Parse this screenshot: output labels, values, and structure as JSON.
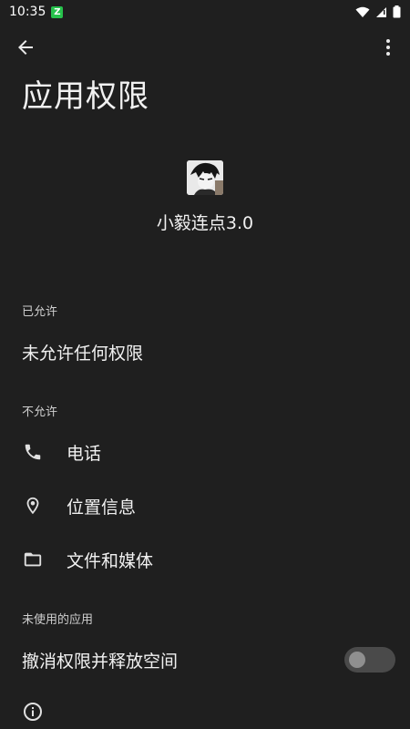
{
  "status_bar": {
    "time": "10:35",
    "app_badge_char": "Z"
  },
  "header": {
    "title": "应用权限"
  },
  "app": {
    "name": "小毅连点3.0"
  },
  "sections": {
    "allowed": {
      "label": "已允许",
      "empty_text": "未允许任何权限"
    },
    "not_allowed": {
      "label": "不允许",
      "items": [
        {
          "label": "电话",
          "icon": "phone-icon"
        },
        {
          "label": "位置信息",
          "icon": "location-icon"
        },
        {
          "label": "文件和媒体",
          "icon": "folder-icon"
        }
      ]
    },
    "unused_apps": {
      "label": "未使用的应用",
      "revoke_label": "撤消权限并释放空间",
      "revoke_enabled": false
    }
  },
  "colors": {
    "background": "#1f1f1f",
    "text": "#f1f1f1",
    "toggle_track": "#4a4a4a",
    "toggle_knob": "#8f8f8f"
  }
}
